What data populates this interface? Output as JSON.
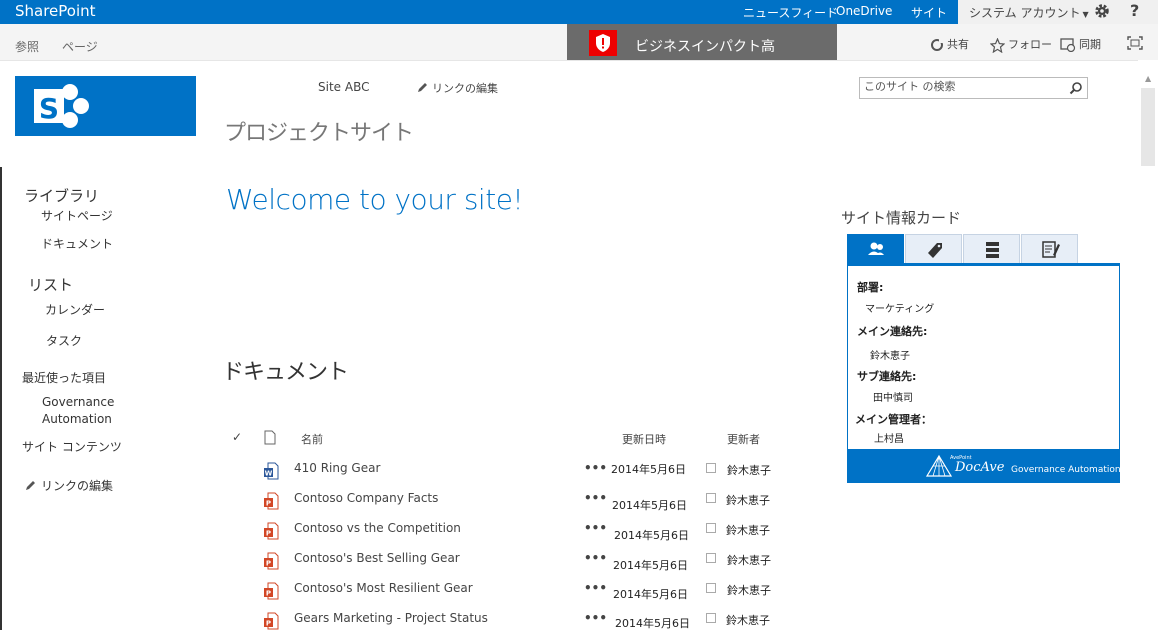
{
  "suite_bar": {
    "brand": "SharePoint",
    "links": [
      "ニュースフィード",
      "OneDrive",
      "サイト"
    ],
    "account": "システム アカウント",
    "help": "?"
  },
  "ribbon": {
    "tabs": [
      "参照",
      "ページ"
    ],
    "notice": "ビジネスインパクト高",
    "actions": [
      "共有",
      "フォロー",
      "同期"
    ]
  },
  "header": {
    "top_nav_site": "Site ABC",
    "top_nav_edit": "リンクの編集",
    "search_placeholder": "このサイト の検索",
    "site_title": "プロジェクトサイト"
  },
  "left_nav": {
    "libraries_heading": "ライブラリ",
    "site_pages": "サイトページ",
    "documents": "ドキュメント",
    "lists_heading": "リスト",
    "calendar": "カレンダー",
    "tasks": "タスク",
    "recent_heading": "最近使った項目",
    "governance_1": "Governance",
    "governance_2": "Automation",
    "site_contents": "サイト コンテンツ",
    "edit_links": "リンクの編集"
  },
  "main": {
    "welcome": "Welcome to your site!",
    "documents_heading": "ドキュメント",
    "columns": {
      "check": "✓",
      "name": "名前",
      "modified": "更新日時",
      "modified_by": "更新者"
    },
    "rows": [
      {
        "type": "word",
        "name": "410 Ring Gear",
        "dots": "•••",
        "date": "2014年5月6日",
        "user": "鈴木恵子"
      },
      {
        "type": "ppt",
        "name": "Contoso Company Facts",
        "dots": "•••",
        "date": "2014年5月6日",
        "user": "鈴木恵子"
      },
      {
        "type": "ppt",
        "name": "Contoso vs the Competition",
        "dots": "•••",
        "date": "2014年5月6日",
        "user": "鈴木恵子"
      },
      {
        "type": "ppt",
        "name": "Contoso's Best Selling Gear",
        "dots": "•••",
        "date": "2014年5月6日",
        "user": "鈴木恵子"
      },
      {
        "type": "ppt",
        "name": "Contoso's Most Resilient Gear",
        "dots": "•••",
        "date": "2014年5月6日",
        "user": "鈴木恵子"
      },
      {
        "type": "ppt",
        "name": "Gears Marketing - Project Status",
        "dots": "•••",
        "date": "2014年5月6日",
        "user": "鈴木恵子"
      }
    ]
  },
  "info_card": {
    "title": "サイト情報カード",
    "department_label": "部署:",
    "department_value": "マーケティング",
    "main_contact_label": "メイン連絡先:",
    "main_contact_value": "鈴木恵子",
    "sub_contact_label": "サブ連絡先:",
    "sub_contact_value": "田中慎司",
    "admin_label": "メイン管理者：",
    "admin_value": "上村昌",
    "footer_pre": "AvePoint",
    "footer_brand": "DocAve",
    "footer_sub": "Governance Automation"
  },
  "colors": {
    "brand_blue": "#0072c6",
    "word_blue": "#2b579a",
    "ppt_red": "#d24726",
    "notice_red": "#e00000"
  }
}
